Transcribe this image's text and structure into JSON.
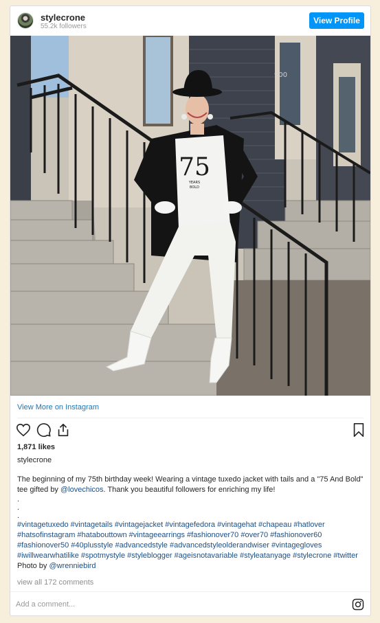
{
  "header": {
    "username": "stylecrone",
    "followers": "55.2k followers",
    "view_profile_label": "View Profile"
  },
  "photo": {
    "alt": "stylecrone"
  },
  "view_more_label": "View More on Instagram",
  "actions": {
    "icons": [
      "heart-icon",
      "comment-icon",
      "share-icon",
      "bookmark-icon"
    ]
  },
  "likes": "1,871 likes",
  "owner": "stylecrone",
  "caption": {
    "text_before": "The beginning of my 75th birthday week! Wearing a vintage tuxedo jacket with tails and a \"75 And Bold\" tee gifted by ",
    "mention": "@lovechicos",
    "text_after": ". Thank you beautiful followers for enriching my life!",
    "dots": [
      ".",
      ".",
      "."
    ],
    "hashtags": "#vintagetuxedo #vintagetails #vintagejacket #vintagefedora #vintagehat #chapeau #hatlover #hatsofinstagram #hatabouttown #vintageearrings #fashionover70 #over70 #fashionover60 #fashionover50 #40plusstyle #advancedstyle #advancedstyleolderandwiser #vintagegloves #iwillwearwhatilike #spotmystyle #styleblogger #ageisnotavariable #styleatanyage #stylecrone #twitter",
    "photo_by": " Photo by ",
    "photographer": "@wrenniebird"
  },
  "comments_link": "view all 172 comments",
  "add_comment_placeholder": "Add a comment...",
  "colors": {
    "page_bg": "#f7efdc",
    "button_blue": "#0095f6",
    "link_blue": "#1877b8",
    "hashtag_blue": "#1b4f86"
  }
}
